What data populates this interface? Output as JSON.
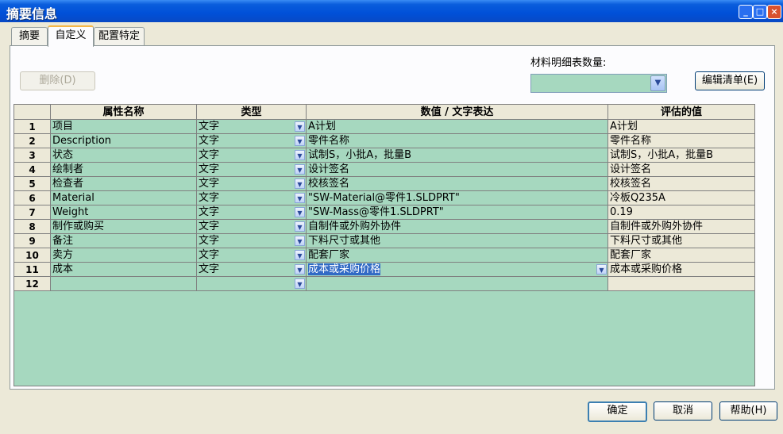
{
  "window": {
    "title": "摘要信息"
  },
  "tabs": [
    {
      "label": "摘要"
    },
    {
      "label": "自定义"
    },
    {
      "label": "配置特定"
    }
  ],
  "toolbar": {
    "delete_label": "删除(D)",
    "bom_qty_label": "材料明细表数量:",
    "bom_qty_value": "",
    "edit_list_label": "编辑清单(E)"
  },
  "grid": {
    "columns": [
      "",
      "属性名称",
      "类型",
      "数值 / 文字表达",
      "评估的值"
    ],
    "rows": [
      {
        "num": "1",
        "name": "项目",
        "type": "文字",
        "value": "A计划",
        "evaluated": "A计划"
      },
      {
        "num": "2",
        "name": "Description",
        "type": "文字",
        "value": "零件名称",
        "evaluated": "零件名称"
      },
      {
        "num": "3",
        "name": "状态",
        "type": "文字",
        "value": "试制S，小批A，批量B",
        "evaluated": "试制S，小批A，批量B"
      },
      {
        "num": "4",
        "name": "绘制者",
        "type": "文字",
        "value": "设计签名",
        "evaluated": "设计签名"
      },
      {
        "num": "5",
        "name": "检查者",
        "type": "文字",
        "value": "校核签名",
        "evaluated": "校核签名"
      },
      {
        "num": "6",
        "name": "Material",
        "type": "文字",
        "value": "\"SW-Material@零件1.SLDPRT\"",
        "evaluated": "冷板Q235A"
      },
      {
        "num": "7",
        "name": "Weight",
        "type": "文字",
        "value": "\"SW-Mass@零件1.SLDPRT\"",
        "evaluated": "0.19"
      },
      {
        "num": "8",
        "name": "制作或购买",
        "type": "文字",
        "value": "自制件或外购外协件",
        "evaluated": "自制件或外购外协件"
      },
      {
        "num": "9",
        "name": "备注",
        "type": "文字",
        "value": "下料尺寸或其他",
        "evaluated": "下料尺寸或其他"
      },
      {
        "num": "10",
        "name": "卖方",
        "type": "文字",
        "value": "配套厂家",
        "evaluated": "配套厂家"
      },
      {
        "num": "11",
        "name": "成本",
        "type": "文字",
        "value": "成本或采购价格",
        "evaluated": "成本或采购价格"
      },
      {
        "num": "12",
        "name": "",
        "type": "",
        "value": "",
        "evaluated": ""
      }
    ]
  },
  "footer": {
    "ok_label": "确定",
    "cancel_label": "取消",
    "help_label": "帮助(H)"
  },
  "colors": {
    "grid_fill": "#a6d8bf",
    "selection": "#316ac5",
    "titlebar": "#0050d8"
  },
  "icons": [
    "minimize-icon",
    "maximize-icon",
    "close-icon",
    "dropdown-arrow-icon"
  ]
}
